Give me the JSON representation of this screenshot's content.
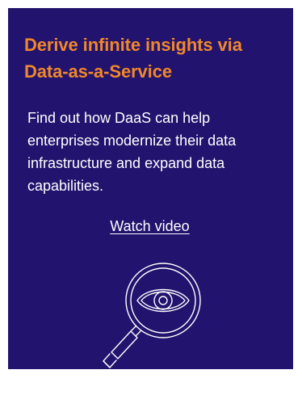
{
  "card": {
    "headline": "Derive infinite insights via\nData-as-a-Service",
    "body": "Find out how DaaS can help enterprises modernize their data infrastructure and expand data capabilities.",
    "cta_label": "Watch video",
    "illustration_icon": "magnifier-eye-icon"
  },
  "colors": {
    "background": "#22136e",
    "headline": "#f0882a",
    "text": "#ffffff"
  }
}
